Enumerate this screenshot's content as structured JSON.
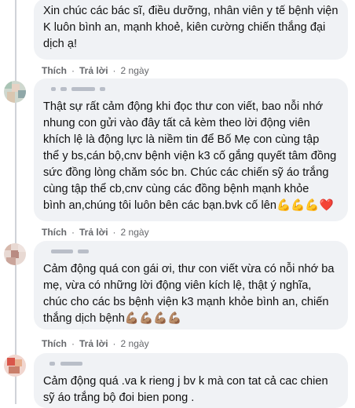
{
  "actions": {
    "like": "Thích",
    "reply": "Trả lời",
    "sep": "·"
  },
  "comments": [
    {
      "text": "Xin chúc các bác sĩ, điều dưỡng, nhân viên y tế bệnh viện\nK luôn bình an, mạnh khoẻ, kiên cường chiến thắng đại\ndịch ạ!",
      "time": "2 ngày"
    },
    {
      "text": "Thật sự rất cảm động khi đọc thư con viết, bao nỗi nhớ\nnhung con gửi vào đây tất cả kèm theo lời động viên\nkhích lệ là động lực là niềm tin để Bố Mẹ con cùng tập\nthể y bs,cán bộ,cnv bệnh viện k3 cố gắng quyết tâm đồng\nsức đồng lòng chăm sóc bn. Chúc các chiến sỹ áo trắng\ncùng tập thể cb,cnv cùng các đồng bệnh mạnh khỏe\nbình an,chúng tôi luôn bên các bạn.bvk cố lên💪💪💪❤️",
      "time": "2 ngày"
    },
    {
      "text": "Cảm động quá con gái ơi, thư con viết vừa có nỗi nhớ ba\nmẹ, vừa có những lời động viên kích lệ, thật ý nghĩa,\nchúc cho các bs bệnh viện k3 mạnh khỏe bình an, chiến\nthắng dịch bệnh💪🏽💪🏽💪🏽💪🏽",
      "time": "2 ngày"
    },
    {
      "text": "Cảm động quá .va k rieng j bv k mà con tat cả cac chien\nsỹ áo trắng bộ đoi bien pong .",
      "time": ""
    }
  ]
}
